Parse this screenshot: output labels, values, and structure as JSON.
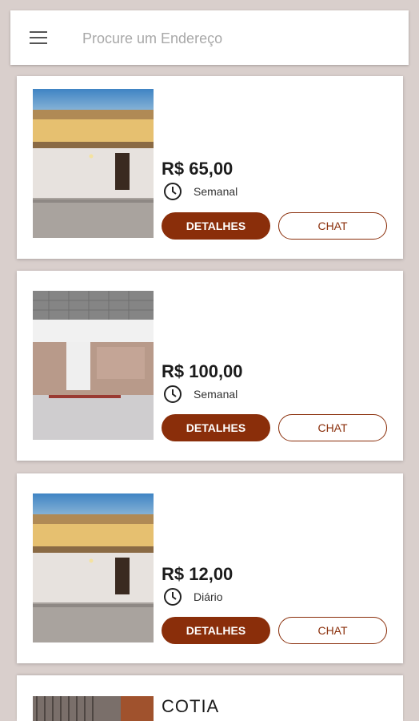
{
  "search": {
    "placeholder": "Procure um Endereço"
  },
  "listings": [
    {
      "price": "R$ 65,00",
      "frequency": "Semanal",
      "details_label": "DETALHES",
      "chat_label": "CHAT"
    },
    {
      "price": "R$ 100,00",
      "frequency": "Semanal",
      "details_label": "DETALHES",
      "chat_label": "CHAT"
    },
    {
      "price": "R$ 12,00",
      "frequency": "Diário",
      "details_label": "DETALHES",
      "chat_label": "CHAT"
    }
  ],
  "partial_listing": {
    "title": "COTIA"
  },
  "colors": {
    "accent": "#8a2e0a",
    "background": "#d9cfcc",
    "card": "#ffffff"
  },
  "icons": [
    "menu-icon",
    "clock-icon"
  ]
}
